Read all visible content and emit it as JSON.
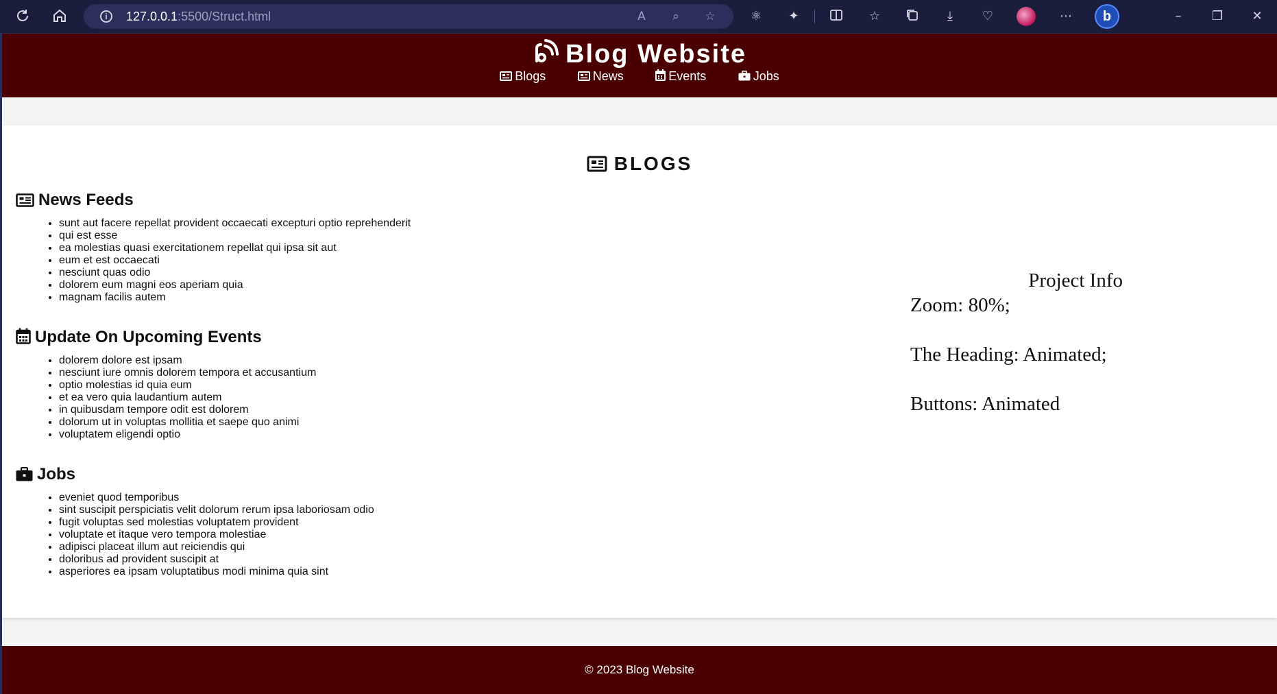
{
  "browser": {
    "url_host": "127.0.0.1",
    "url_path": ":5500/Struct.html",
    "icons": [
      "reload-icon",
      "home-icon",
      "info-icon",
      "read-aloud-icon",
      "zoom-out-icon",
      "favorite-star-icon",
      "react-devtools-icon",
      "extensions-icon",
      "split-screen-icon",
      "favorites-icon",
      "collections-icon",
      "downloads-icon",
      "browser-essentials-icon",
      "profile-avatar",
      "more-menu-icon",
      "copilot-bing-icon",
      "minimize-icon",
      "restore-icon",
      "close-icon"
    ]
  },
  "header": {
    "title": "Blog Website",
    "nav": [
      {
        "label": "Blogs",
        "icon": "newspaper-icon"
      },
      {
        "label": "News",
        "icon": "newspaper-icon"
      },
      {
        "label": "Events",
        "icon": "calendar-icon"
      },
      {
        "label": "Jobs",
        "icon": "briefcase-icon"
      }
    ]
  },
  "main": {
    "section_title": "BLOGS",
    "blocks": [
      {
        "title": "News Feeds",
        "icon": "newspaper-icon",
        "items": [
          "sunt aut facere repellat provident occaecati excepturi optio reprehenderit",
          "qui est esse",
          "ea molestias quasi exercitationem repellat qui ipsa sit aut",
          "eum et est occaecati",
          "nesciunt quas odio",
          "dolorem eum magni eos aperiam quia",
          "magnam facilis autem"
        ]
      },
      {
        "title": "Update On Upcoming Events",
        "icon": "calendar-icon",
        "items": [
          "dolorem dolore est ipsam",
          "nesciunt iure omnis dolorem tempora et accusantium",
          "optio molestias id quia eum",
          "et ea vero quia laudantium autem",
          "in quibusdam tempore odit est dolorem",
          "dolorum ut in voluptas mollitia et saepe quo animi",
          "voluptatem eligendi optio"
        ]
      },
      {
        "title": "Jobs",
        "icon": "briefcase-icon",
        "items": [
          "eveniet quod temporibus",
          "sint suscipit perspiciatis velit dolorum rerum ipsa laboriosam odio",
          "fugit voluptas sed molestias voluptatem provident",
          "voluptate et itaque vero tempora molestiae",
          "adipisci placeat illum aut reiciendis qui",
          "doloribus ad provident suscipit at",
          "asperiores ea ipsam voluptatibus modi minima quia sint"
        ]
      }
    ],
    "project_info": {
      "title": "Project Info",
      "lines": [
        "Zoom: 80%;",
        "The Heading: Animated;",
        "Buttons: Animated"
      ]
    }
  },
  "footer": {
    "text": "© 2023 Blog Website"
  },
  "colors": {
    "brand": "#4a0000",
    "chrome": "#1a1d3b",
    "address_bar": "#2b2f5c",
    "page_bg": "#f4f4f4"
  }
}
